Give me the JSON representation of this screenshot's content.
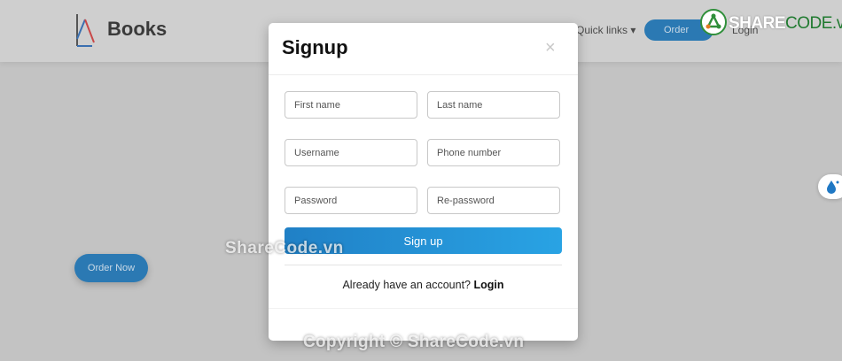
{
  "header": {
    "logo_text": "Books",
    "quick_links_label": "Quick links",
    "quick_links_caret": "▾",
    "cta_label": "Order",
    "login_label": "Login"
  },
  "hero": {
    "order_button_label": "Order Now"
  },
  "watermarks": {
    "brand_main": "SHARE",
    "brand_accent": "CODE.vn",
    "center_text": "ShareCode.vn",
    "copyright_text": "Copyright © ShareCode.vn"
  },
  "modal": {
    "title": "Signup",
    "close_symbol": "×",
    "fields": {
      "first_name": "First name",
      "last_name": "Last name",
      "username": "Username",
      "phone": "Phone number",
      "password": "Password",
      "repassword": "Re-password"
    },
    "submit_label": "Sign up",
    "switch_prompt": "Already have an account?",
    "switch_link": "Login"
  },
  "colors": {
    "overlay_background": "#c3c3c3",
    "primary_start": "#2080c6",
    "primary_end": "#29a3e4",
    "modal_background": "#ffffff"
  },
  "icons": {
    "logo": "book-logo-icon",
    "close": "close-icon",
    "side_widget": "water-drop-icon",
    "brand": "sharecode-logo-icon"
  }
}
